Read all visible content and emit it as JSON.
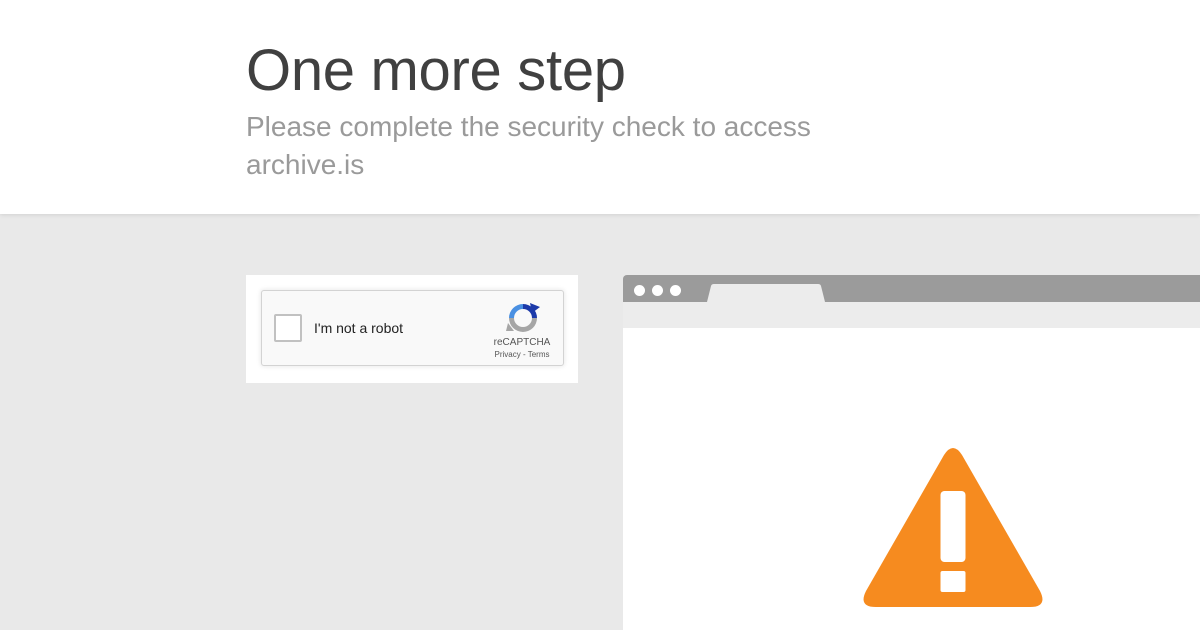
{
  "header": {
    "title": "One more step",
    "subtitle": "Please complete the security check to access archive.is"
  },
  "captcha": {
    "checkbox_label": "I'm not a robot",
    "brand": "reCAPTCHA",
    "privacy_link": "Privacy",
    "separator": " - ",
    "terms_link": "Terms",
    "checked": false
  },
  "illustration": {
    "icons": [
      "browser-window-icon",
      "warning-icon"
    ],
    "warning_color": "#f68b1f",
    "browser_bar_color": "#9b9b9b"
  },
  "colors": {
    "page_background": "#e9e9e9",
    "title": "#404040",
    "subtitle": "#9a9a9a"
  }
}
